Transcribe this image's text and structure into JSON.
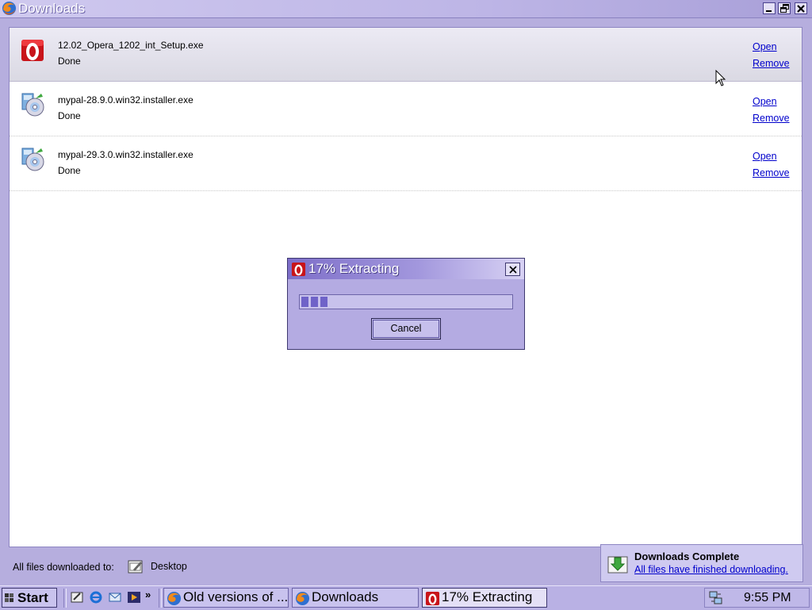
{
  "window": {
    "title": "Downloads",
    "icon": "firefox-icon",
    "controls": [
      "minimize-icon",
      "restore-icon",
      "close-icon"
    ]
  },
  "downloads": [
    {
      "name": "12.02_Opera_1202_int_Setup.exe",
      "status": "Done",
      "icon": "opera-icon",
      "open_label": "Open",
      "remove_label": "Remove",
      "selected": true
    },
    {
      "name": "mypal-28.9.0.win32.installer.exe",
      "status": "Done",
      "icon": "installer-cd-icon",
      "open_label": "Open",
      "remove_label": "Remove",
      "selected": false
    },
    {
      "name": "mypal-29.3.0.win32.installer.exe",
      "status": "Done",
      "icon": "installer-cd-icon",
      "open_label": "Open",
      "remove_label": "Remove",
      "selected": false
    }
  ],
  "statusbar": {
    "label": "All files downloaded to:",
    "folder": "Desktop",
    "folder_icon": "desktop-folder-icon"
  },
  "notification": {
    "title": "Downloads Complete",
    "link": "All files have finished downloading.",
    "icon": "download-complete-icon"
  },
  "dialog": {
    "title": "17% Extracting",
    "icon": "opera-icon",
    "progress": 0.17,
    "cancel_label": "Cancel"
  },
  "taskbar": {
    "start_label": "Start",
    "quicklaunch": [
      "show-desktop-icon",
      "internet-explorer-icon",
      "outlook-express-icon",
      "media-player-icon"
    ],
    "more": "»",
    "tasks": [
      {
        "label": "Old versions of ...",
        "icon": "firefox-icon",
        "active": false
      },
      {
        "label": "Downloads",
        "icon": "firefox-icon",
        "active": false
      },
      {
        "label": "17% Extracting",
        "icon": "opera-icon",
        "active": true
      }
    ],
    "clock": "9:55 PM",
    "tray_icon": "network-icon"
  },
  "colors": {
    "desktop_bg": "#b6aede",
    "titlebar": "#bdb5e6",
    "selected_row": "#dad9e3",
    "link": "#0000cc",
    "progress_fill": "#6f63c8"
  }
}
